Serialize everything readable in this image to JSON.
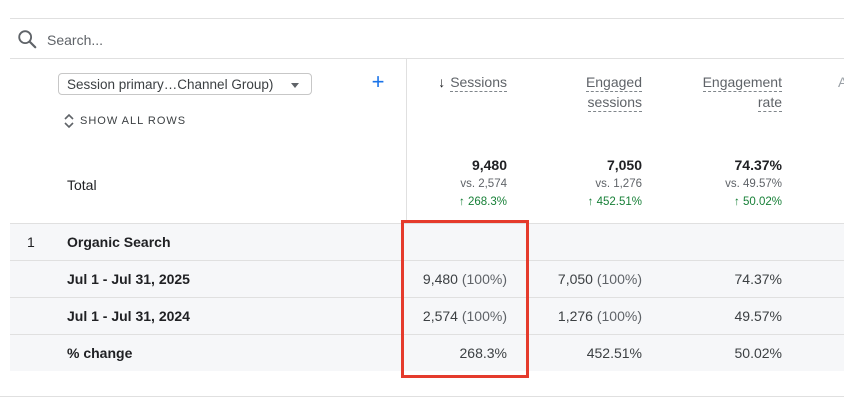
{
  "search": {
    "placeholder": "Search..."
  },
  "dimension_selector": {
    "value": "Session primary…Channel Group)"
  },
  "add_dimension_label": "+",
  "show_all_rows_label": "SHOW ALL ROWS",
  "columns": [
    {
      "label_line1": "Sessions",
      "label_line2": ""
    },
    {
      "label_line1": "Engaged",
      "label_line2": "sessions"
    },
    {
      "label_line1": "Engagement",
      "label_line2": "rate"
    }
  ],
  "totals": {
    "label": "Total",
    "cells": [
      {
        "value": "9,480",
        "vs": "vs. 2,574",
        "change": "268.3%"
      },
      {
        "value": "7,050",
        "vs": "vs. 1,276",
        "change": "452.51%"
      },
      {
        "value": "74.37%",
        "vs": "vs. 49.57%",
        "change": "50.02%"
      }
    ]
  },
  "rows": [
    {
      "index": "1",
      "label": "Organic Search"
    },
    {
      "label": "Jul 1 - Jul 31, 2025",
      "cells": [
        {
          "value": "9,480",
          "pct": "(100%)"
        },
        {
          "value": "7,050",
          "pct": "(100%)"
        },
        {
          "value": "74.37%",
          "pct": ""
        }
      ]
    },
    {
      "label": "Jul 1 - Jul 31, 2024",
      "cells": [
        {
          "value": "2,574",
          "pct": "(100%)"
        },
        {
          "value": "1,276",
          "pct": "(100%)"
        },
        {
          "value": "49.57%",
          "pct": ""
        }
      ]
    },
    {
      "label": "% change",
      "cells": [
        {
          "value": "268.3%",
          "pct": ""
        },
        {
          "value": "452.51%",
          "pct": ""
        },
        {
          "value": "50.02%",
          "pct": ""
        }
      ]
    }
  ],
  "colors": {
    "accent": "#1a73e8",
    "positive": "#188038",
    "highlight_border": "#e53b2c"
  }
}
